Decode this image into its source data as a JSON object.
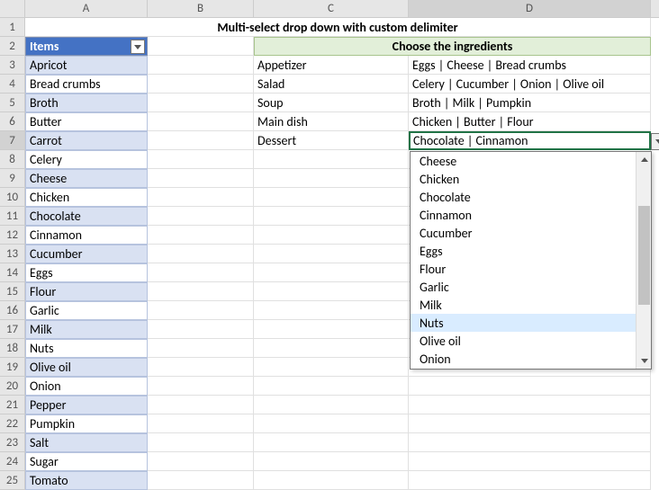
{
  "title": "Multi-select drop down with custom delimiter",
  "columns": [
    "A",
    "B",
    "C",
    "D"
  ],
  "items_header": "Items",
  "ingredients_header": "Choose the ingredients",
  "items": [
    "Apricot",
    "Bread crumbs",
    "Broth",
    "Butter",
    "Carrot",
    "Celery",
    "Cheese",
    "Chicken",
    "Chocolate",
    "Cinnamon",
    "Cucumber",
    "Eggs",
    "Flour",
    "Garlic",
    "Milk",
    "Nuts",
    "Olive oil",
    "Onion",
    "Pepper",
    "Pumpkin",
    "Salt",
    "Sugar",
    "Tomato"
  ],
  "pairs": [
    {
      "label": "Appetizer",
      "value": "Eggs | Cheese | Bread crumbs"
    },
    {
      "label": "Salad",
      "value": "Celery | Cucumber | Onion | Olive oil"
    },
    {
      "label": "Soup",
      "value": "Broth | Milk | Pumpkin"
    },
    {
      "label": "Main dish",
      "value": "Chicken | Butter | Flour"
    },
    {
      "label": "Dessert",
      "value": "Chocolate | Cinnamon"
    }
  ],
  "dropdown": {
    "visible_options": [
      "Cheese",
      "Chicken",
      "Chocolate",
      "Cinnamon",
      "Cucumber",
      "Eggs",
      "Flour",
      "Garlic",
      "Milk",
      "Nuts",
      "Olive oil",
      "Onion"
    ],
    "highlight_index": 9
  },
  "selected_cell": "D7"
}
